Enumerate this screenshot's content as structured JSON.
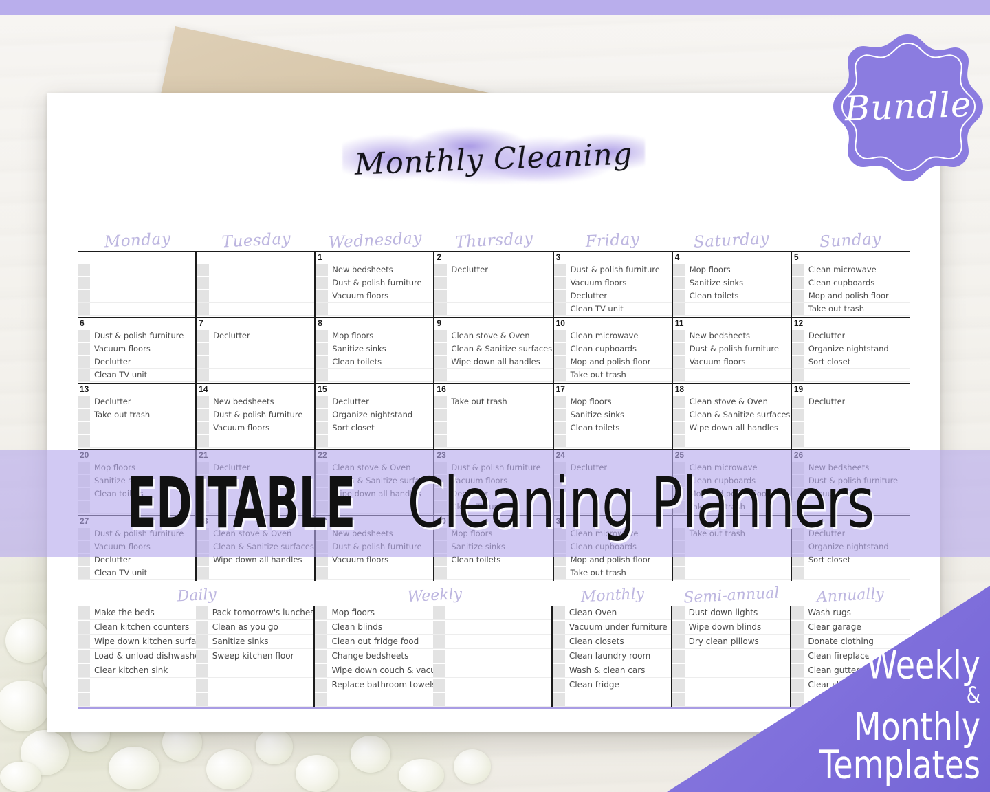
{
  "brand": {
    "badge_label": "Bundle",
    "banner_editable": "EDITABLE",
    "banner_rest": "Cleaning Planners",
    "corner_line1": "Weekly",
    "corner_amp": "&",
    "corner_line2": "Monthly",
    "corner_line3": "Templates",
    "accent_purple": "#8b7ce0",
    "accent_lavender": "#b9aeec",
    "header_script_color": "#bdb6e0"
  },
  "planner": {
    "title": "Monthly Cleaning",
    "days_of_week": [
      "Monday",
      "Tuesday",
      "Wednesday",
      "Thursday",
      "Friday",
      "Saturday",
      "Sunday"
    ],
    "weeks": [
      [
        {
          "num": "",
          "tasks": []
        },
        {
          "num": "",
          "tasks": []
        },
        {
          "num": "1",
          "tasks": [
            "New bedsheets",
            "Dust & polish furniture",
            "Vacuum floors"
          ]
        },
        {
          "num": "2",
          "tasks": [
            "Declutter"
          ]
        },
        {
          "num": "3",
          "tasks": [
            "Dust & polish furniture",
            "Vacuum floors",
            "Declutter",
            "Clean TV unit"
          ]
        },
        {
          "num": "4",
          "tasks": [
            "Mop floors",
            "Sanitize sinks",
            "Clean toilets"
          ]
        },
        {
          "num": "5",
          "tasks": [
            "Clean microwave",
            "Clean cupboards",
            "Mop and polish floor",
            "Take out trash"
          ]
        }
      ],
      [
        {
          "num": "6",
          "tasks": [
            "Dust & polish furniture",
            "Vacuum floors",
            "Declutter",
            "Clean TV unit"
          ]
        },
        {
          "num": "7",
          "tasks": [
            "Declutter"
          ]
        },
        {
          "num": "8",
          "tasks": [
            "Mop floors",
            "Sanitize sinks",
            "Clean toilets"
          ]
        },
        {
          "num": "9",
          "tasks": [
            "Clean stove & Oven",
            "Clean & Sanitize surfaces",
            "Wipe down all handles"
          ]
        },
        {
          "num": "10",
          "tasks": [
            "Clean microwave",
            "Clean cupboards",
            "Mop and polish floor",
            "Take out trash"
          ]
        },
        {
          "num": "11",
          "tasks": [
            "New bedsheets",
            "Dust & polish furniture",
            "Vacuum floors"
          ]
        },
        {
          "num": "12",
          "tasks": [
            "Declutter",
            "Organize nightstand",
            "Sort closet"
          ]
        }
      ],
      [
        {
          "num": "13",
          "tasks": [
            "Declutter",
            "Take out trash"
          ]
        },
        {
          "num": "14",
          "tasks": [
            "New bedsheets",
            "Dust & polish furniture",
            "Vacuum floors"
          ]
        },
        {
          "num": "15",
          "tasks": [
            "Declutter",
            "Organize nightstand",
            "Sort closet"
          ]
        },
        {
          "num": "16",
          "tasks": [
            "Take out trash"
          ]
        },
        {
          "num": "17",
          "tasks": [
            "Mop floors",
            "Sanitize sinks",
            "Clean toilets"
          ]
        },
        {
          "num": "18",
          "tasks": [
            "Clean stove & Oven",
            "Clean & Sanitize surfaces",
            "Wipe down all handles"
          ]
        },
        {
          "num": "19",
          "tasks": [
            "Declutter"
          ]
        }
      ],
      [
        {
          "num": "20",
          "tasks": [
            "Mop floors",
            "Sanitize sinks",
            "Clean toilets"
          ]
        },
        {
          "num": "21",
          "tasks": [
            "Declutter"
          ]
        },
        {
          "num": "22",
          "tasks": [
            "Clean stove & Oven",
            "Clean & Sanitize surfaces",
            "Wipe down all handles"
          ]
        },
        {
          "num": "23",
          "tasks": [
            "Dust & polish furniture",
            "Vacuum floors",
            "Declutter",
            "Clean TV unit"
          ]
        },
        {
          "num": "24",
          "tasks": [
            "Declutter"
          ]
        },
        {
          "num": "25",
          "tasks": [
            "Clean microwave",
            "Clean cupboards",
            "Mop and polish floor",
            "Take out trash"
          ]
        },
        {
          "num": "26",
          "tasks": [
            "New bedsheets",
            "Dust & polish furniture",
            "Vacuum floors"
          ]
        }
      ],
      [
        {
          "num": "27",
          "tasks": [
            "Dust & polish furniture",
            "Vacuum floors",
            "Declutter",
            "Clean TV unit"
          ]
        },
        {
          "num": "28",
          "tasks": [
            "Clean stove & Oven",
            "Clean & Sanitize surfaces",
            "Wipe down all handles"
          ]
        },
        {
          "num": "29",
          "tasks": [
            "New bedsheets",
            "Dust & polish furniture",
            "Vacuum floors"
          ]
        },
        {
          "num": "30",
          "tasks": [
            "Mop floors",
            "Sanitize sinks",
            "Clean toilets"
          ]
        },
        {
          "num": "31",
          "tasks": [
            "Clean microwave",
            "Clean cupboards",
            "Mop and polish floor",
            "Take out trash"
          ]
        },
        {
          "num": "",
          "tasks": [
            "Take out trash"
          ]
        },
        {
          "num": "",
          "tasks": [
            "Declutter",
            "Organize nightstand",
            "Sort closet"
          ]
        }
      ]
    ],
    "frequency_sections": [
      {
        "heading": "Daily",
        "columns": [
          [
            "Make the beds",
            "Clean kitchen counters",
            "Wipe down kitchen surfaces",
            "Load & unload dishwasher",
            "Clear kitchen sink",
            "",
            ""
          ],
          [
            "Pack tomorrow's lunches",
            "Clean as you go",
            "Sanitize sinks",
            "Sweep kitchen floor",
            "",
            "",
            ""
          ]
        ]
      },
      {
        "heading": "Weekly",
        "columns": [
          [
            "Mop floors",
            "Clean blinds",
            "Clean out fridge food",
            "Change bedsheets",
            "Wipe down couch & vacuum",
            "Replace bathroom towels",
            ""
          ],
          [
            "",
            "",
            "",
            "",
            "",
            "",
            ""
          ]
        ]
      },
      {
        "heading": "Monthly",
        "columns": [
          [
            "Clean Oven",
            "Vacuum under furniture",
            "Clean closets",
            "Clean laundry room",
            "Wash & clean cars",
            "Clean fridge",
            ""
          ]
        ]
      },
      {
        "heading": "Semi-annual",
        "columns": [
          [
            "Dust down lights",
            "Wipe down blinds",
            "Dry clean pillows",
            "",
            "",
            "",
            ""
          ]
        ]
      },
      {
        "heading": "Annually",
        "columns": [
          [
            "Wash rugs",
            "Clear garage",
            "Donate clothing",
            "Clean fireplace",
            "Clean gutters",
            "Clear shed",
            ""
          ]
        ]
      }
    ]
  }
}
